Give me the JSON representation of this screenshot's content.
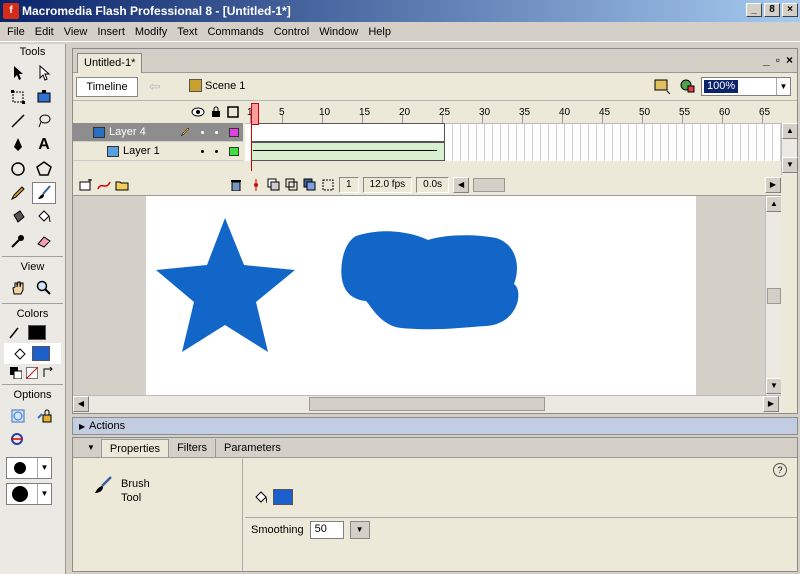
{
  "window": {
    "title": "Macromedia Flash Professional 8 - [Untitled-1*]",
    "controls": [
      "_",
      "8",
      "×"
    ]
  },
  "menu": [
    "File",
    "Edit",
    "View",
    "Insert",
    "Modify",
    "Text",
    "Commands",
    "Control",
    "Window",
    "Help"
  ],
  "tools": {
    "title": "Tools",
    "view_title": "View",
    "colors_title": "Colors",
    "options_title": "Options",
    "stroke_color": "#000000",
    "fill_color": "#1a5fcc"
  },
  "document": {
    "tab": "Untitled-1*",
    "timeline_button": "Timeline",
    "scene": "Scene 1",
    "zoom": "100%",
    "layers": [
      {
        "name": "Layer 4",
        "color": "#e040e0"
      },
      {
        "name": "Layer 1",
        "color": "#40e040"
      }
    ],
    "ruler": [
      "1",
      "5",
      "10",
      "15",
      "20",
      "25",
      "30",
      "35",
      "40",
      "45",
      "50",
      "55",
      "60",
      "65"
    ],
    "current_frame": "1",
    "fps": "12.0 fps",
    "elapsed": "0.0s",
    "shape_color": "#1266c8"
  },
  "panels": {
    "actions": "Actions",
    "tabs": [
      "Properties",
      "Filters",
      "Parameters"
    ],
    "tool_name_1": "Brush",
    "tool_name_2": "Tool",
    "fill_color": "#1a5fcc",
    "smoothing_label": "Smoothing",
    "smoothing_value": "50",
    "help": "?"
  }
}
